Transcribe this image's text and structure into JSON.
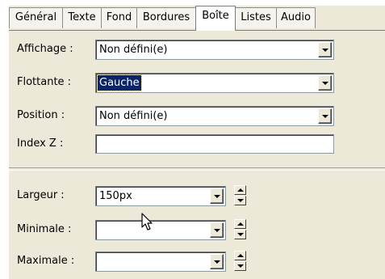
{
  "tabs": [
    {
      "label": "Général",
      "active": false
    },
    {
      "label": "Texte",
      "active": false
    },
    {
      "label": "Fond",
      "active": false
    },
    {
      "label": "Bordures",
      "active": false
    },
    {
      "label": "Boîte",
      "active": true
    },
    {
      "label": "Listes",
      "active": false
    },
    {
      "label": "Audio",
      "active": false
    }
  ],
  "rows": {
    "affichage": {
      "label": "Affichage :",
      "value": "Non défini(e)"
    },
    "flottante": {
      "label": "Flottante :",
      "value": "Gauche"
    },
    "position": {
      "label": "Position :",
      "value": "Non défini(e)"
    },
    "index_z": {
      "label": "Index Z :",
      "value": ""
    },
    "largeur": {
      "label": "Largeur :",
      "value": "150px"
    },
    "minimale": {
      "label": "Minimale :",
      "value": ""
    },
    "maximale": {
      "label": "Maximale :",
      "value": ""
    }
  },
  "icons": {
    "cursor": "mouse-pointer-icon",
    "dropdown": "chevron-down-icon",
    "spin": "spin-arrows-icon"
  },
  "colors": {
    "dialog_bg": "#ece9d8",
    "selection_bg": "#0a246a",
    "field_bg": "#ffffff"
  }
}
